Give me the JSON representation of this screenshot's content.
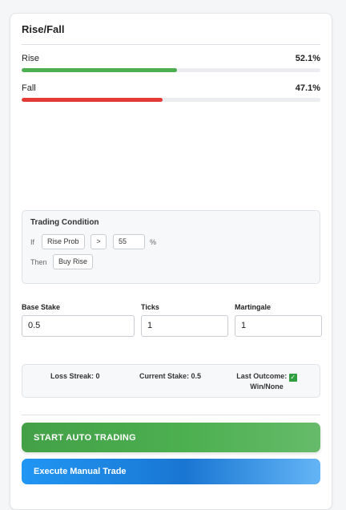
{
  "card": {
    "title": "Rise/Fall"
  },
  "probabilities": {
    "rise": {
      "label": "Rise",
      "value_text": "52.1%",
      "fraction": 0.521,
      "color": "#4caf50"
    },
    "fall": {
      "label": "Fall",
      "value_text": "47.1%",
      "fraction": 0.471,
      "color": "#e53935"
    }
  },
  "trading_condition": {
    "title": "Trading Condition",
    "if_label": "If",
    "metric": "Rise Prob",
    "operator": ">",
    "threshold": "55",
    "unit": "%",
    "then_label": "Then",
    "action": "Buy Rise"
  },
  "settings": {
    "base_stake": {
      "label": "Base Stake",
      "value": "0.5"
    },
    "ticks": {
      "label": "Ticks",
      "value": "1"
    },
    "martingale": {
      "label": "Martingale",
      "value": "1"
    }
  },
  "status": {
    "loss_streak": "Loss Streak: 0",
    "current_stake": "Current Stake: 0.5",
    "last_outcome_label": "Last Outcome:",
    "last_outcome_icon": "check-icon",
    "last_outcome_value": "Win/None"
  },
  "buttons": {
    "auto": "START AUTO TRADING",
    "manual": "Execute Manual Trade"
  }
}
